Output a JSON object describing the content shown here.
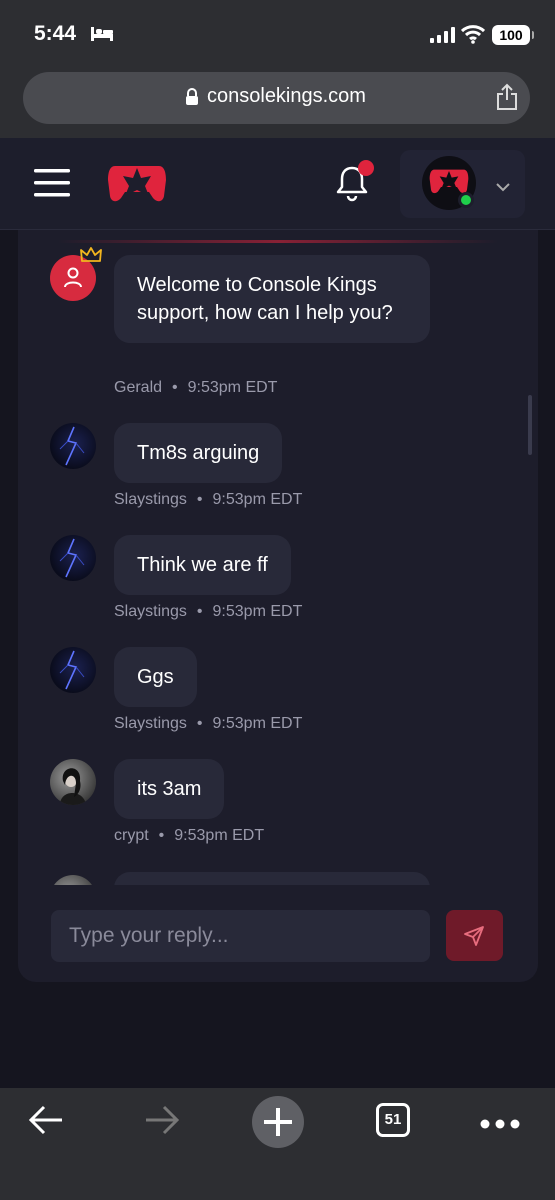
{
  "status_bar": {
    "time": "5:44",
    "battery": "100"
  },
  "browser": {
    "url": "consolekings.com",
    "tab_count": "51"
  },
  "header": {
    "notification_badge": true,
    "user_online": true
  },
  "messages": [
    {
      "author": "Gerald",
      "time": "9:53pm EDT",
      "text": "Welcome to Console Kings support, how can I help you?",
      "role": "support"
    },
    {
      "author": "Slaystings",
      "time": "9:53pm EDT",
      "text": "Tm8s arguing",
      "role": "user"
    },
    {
      "author": "Slaystings",
      "time": "9:53pm EDT",
      "text": "Think we are ff",
      "role": "user"
    },
    {
      "author": "Slaystings",
      "time": "9:53pm EDT",
      "text": "Ggs",
      "role": "user"
    },
    {
      "author": "crypt",
      "time": "9:53pm EDT",
      "text": "its 3am",
      "role": "user"
    }
  ],
  "meta_separator": "•",
  "reply": {
    "placeholder": "Type your reply..."
  },
  "colors": {
    "brand": "#e0243d",
    "online": "#1fcf4b",
    "panel": "#1d1d2b",
    "bubble": "#282939"
  },
  "icons": [
    "bed-icon",
    "signal-icon",
    "wifi-icon",
    "lock-icon",
    "share-icon",
    "menu-icon",
    "bell-icon",
    "chevron-down-icon",
    "crown-icon",
    "send-icon",
    "back-arrow-icon",
    "forward-arrow-icon",
    "plus-icon",
    "more-icon"
  ]
}
